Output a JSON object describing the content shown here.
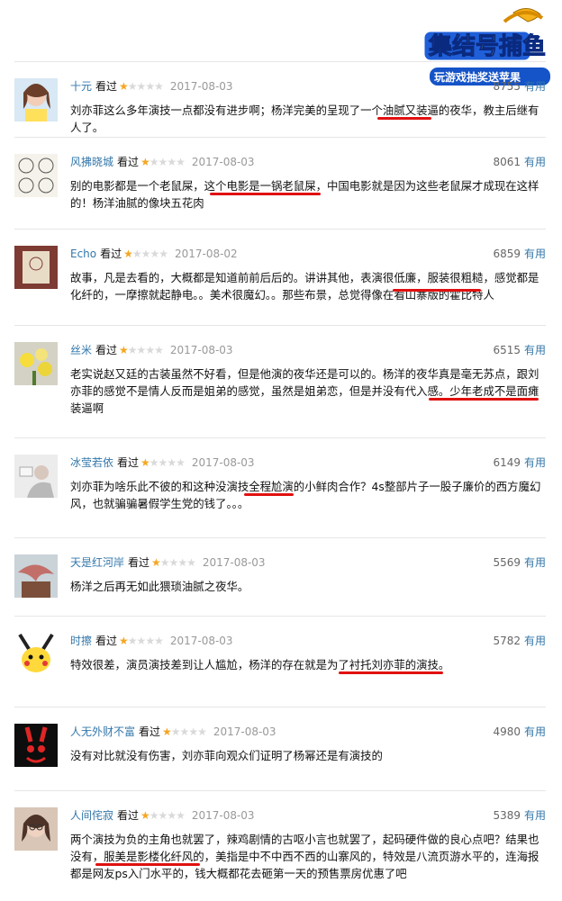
{
  "logo": {
    "line1": "集结号",
    "line2": "捕鱼",
    "line3": "玩游戏抽奖送苹果"
  },
  "rating_icon": "star-icon",
  "reviews": [
    {
      "user": "十元",
      "saw_label": "看过",
      "stars": 1,
      "date": "2017-08-03",
      "votes": "8755",
      "useful_label": "有用",
      "text": "刘亦菲这么多年演技一点都没有进步啊；杨洋完美的呈现了一个油腻又装逼的夜华，教主后继有人了。",
      "avatar": "avatar-woman-light"
    },
    {
      "user": "风拂晓城",
      "saw_label": "看过",
      "stars": 1,
      "date": "2017-08-03",
      "votes": "8061",
      "useful_label": "有用",
      "text": "别的电影都是一个老鼠屎，这个电影是一锅老鼠屎，中国电影就是因为这些老鼠屎才成现在这样的！杨洋油腻的像块五花肉",
      "avatar": "avatar-doodle-faces"
    },
    {
      "user": "Echo",
      "saw_label": "看过",
      "stars": 1,
      "date": "2017-08-02",
      "votes": "6859",
      "useful_label": "有用",
      "text": "故事，凡是去看的，大概都是知道前前后后的。讲讲其他，表演很低廉，服装很粗糙，感觉都是化纤的，一摩擦就起静电。。美术很魔幻。。那些布景，总觉得像在看山寨版的霍比特人",
      "avatar": "avatar-book"
    },
    {
      "user": "丝米",
      "saw_label": "看过",
      "stars": 1,
      "date": "2017-08-03",
      "votes": "6515",
      "useful_label": "有用",
      "text": "老实说赵又廷的古装虽然不好看，但是他演的夜华还是可以的。杨洋的夜华真是毫无苏点，跟刘亦菲的感觉不是情人反而是姐弟的感觉，虽然是姐弟恋，但是并没有代入感。少年老成不是面瘫装逼啊",
      "avatar": "avatar-flowers"
    },
    {
      "user": "冰莹若依",
      "saw_label": "看过",
      "stars": 1,
      "date": "2017-08-03",
      "votes": "6149",
      "useful_label": "有用",
      "text": "刘亦菲为啥乐此不彼的和这种没演技全程尬演的小鲜肉合作？4s整部片子一股子廉价的西方魔幻风，也就骗骗暑假学生党的钱了。。。",
      "avatar": "avatar-person-sketch"
    },
    {
      "user": "天是红河岸",
      "saw_label": "看过",
      "stars": 1,
      "date": "2017-08-03",
      "votes": "5569",
      "useful_label": "有用",
      "text": "杨洋之后再无如此猥琐油腻之夜华。",
      "avatar": "avatar-blossom"
    },
    {
      "user": "时擦",
      "saw_label": "看过",
      "stars": 1,
      "date": "2017-08-03",
      "votes": "5782",
      "useful_label": "有用",
      "text": "特效很差，演员演技差到让人尴尬，杨洋的存在就是为了衬托刘亦菲的演技。",
      "avatar": "avatar-pikachu"
    },
    {
      "user": "人无外财不富",
      "saw_label": "看过",
      "stars": 1,
      "date": "2017-08-03",
      "votes": "4980",
      "useful_label": "有用",
      "text": "没有对比就没有伤害，刘亦菲向观众们证明了杨幂还是有演技的",
      "avatar": "avatar-red-rabbit"
    },
    {
      "user": "人间侘寂",
      "saw_label": "看过",
      "stars": 1,
      "date": "2017-08-03",
      "votes": "5389",
      "useful_label": "有用",
      "text": "两个演技为负的主角也就罢了，辣鸡剧情的古呕小言也就罢了，起码硬件做的良心点吧？结果也没有，服美是影楼化纤风的，美指是中不中西不西的山寨风的，特效是八流页游水平的，连海报都是网友ps入门水平的，钱大概都花去砸第一天的预售票房优惠了吧",
      "avatar": "avatar-girl-glasses"
    }
  ]
}
